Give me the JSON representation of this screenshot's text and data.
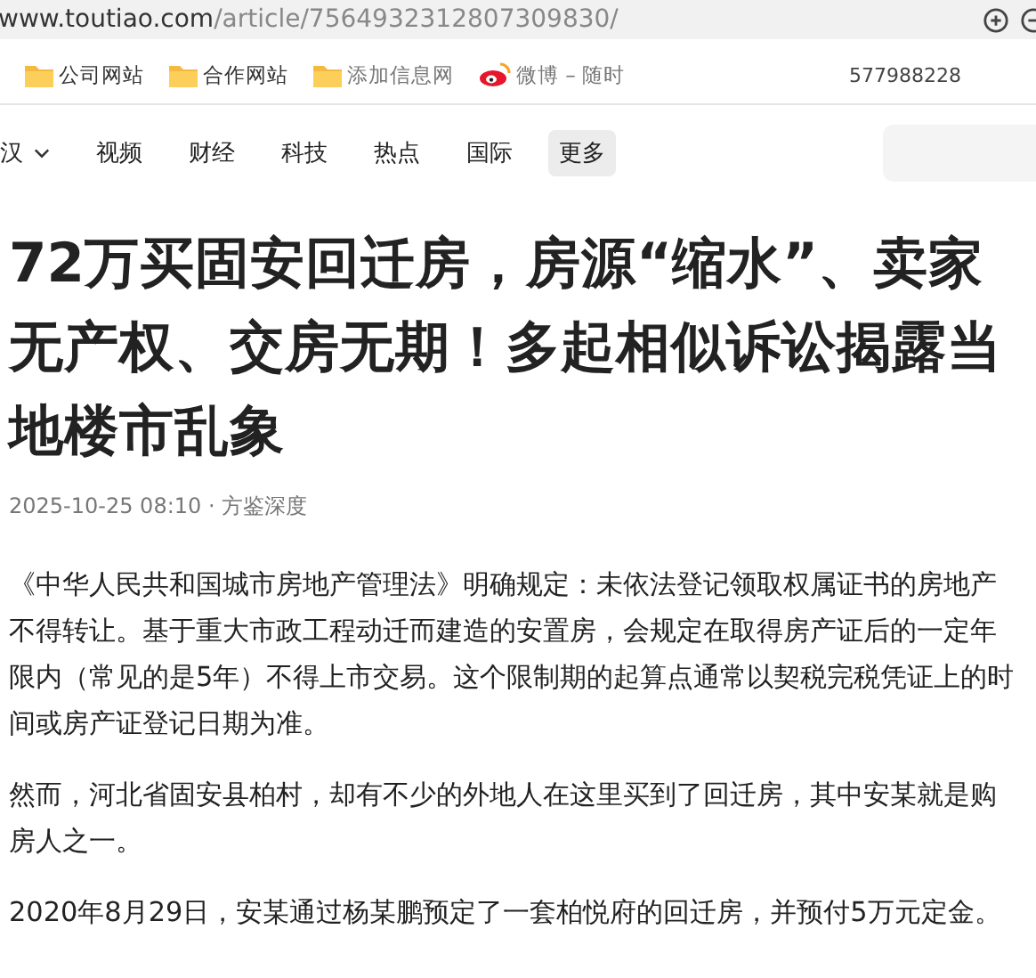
{
  "address_bar": {
    "domain": "www.toutiao.com",
    "path": "/article/7564932312807309830/"
  },
  "bookmarks": [
    {
      "label": "公司网站",
      "kind": "folder"
    },
    {
      "label": "合作网站",
      "kind": "folder"
    },
    {
      "label": "添加信息网",
      "kind": "folder"
    },
    {
      "label": "微博 – 随时",
      "kind": "weibo"
    }
  ],
  "bookmark_bar_text": "577988228",
  "nav": [
    {
      "label": "汉",
      "kind": "dropdown",
      "selected": false
    },
    {
      "label": "视频",
      "kind": "link",
      "selected": false
    },
    {
      "label": "财经",
      "kind": "link",
      "selected": false
    },
    {
      "label": "科技",
      "kind": "link",
      "selected": false
    },
    {
      "label": "热点",
      "kind": "link",
      "selected": false
    },
    {
      "label": "国际",
      "kind": "link",
      "selected": false
    },
    {
      "label": "更多",
      "kind": "link",
      "selected": true
    }
  ],
  "article": {
    "title": "72万买固安回迁房，房源“缩水”、卖家无产权、交房无期！多起相似诉讼揭露当地楼市乱象",
    "meta": "2025-10-25 08:10 · 方鉴深度",
    "paragraphs": [
      "《中华人民共和国城市房地产管理法》明确规定：未依法登记领取权属证书的房地产不得转让。基于重大市政工程动迁而建造的安置房，会规定在取得房产证后的一定年限内（常见的是5年）不得上市交易。这个限制期的起算点通常以契税完税凭证上的时间或房产证登记日期为准。",
      "然而，河北省固安县柏村，却有不少的外地人在这里买到了回迁房，其中安某就是购房人之一。",
      "2020年8月29日，安某通过杨某鹏预定了一套柏悦府的回迁房，并预付5万元定金。"
    ]
  }
}
